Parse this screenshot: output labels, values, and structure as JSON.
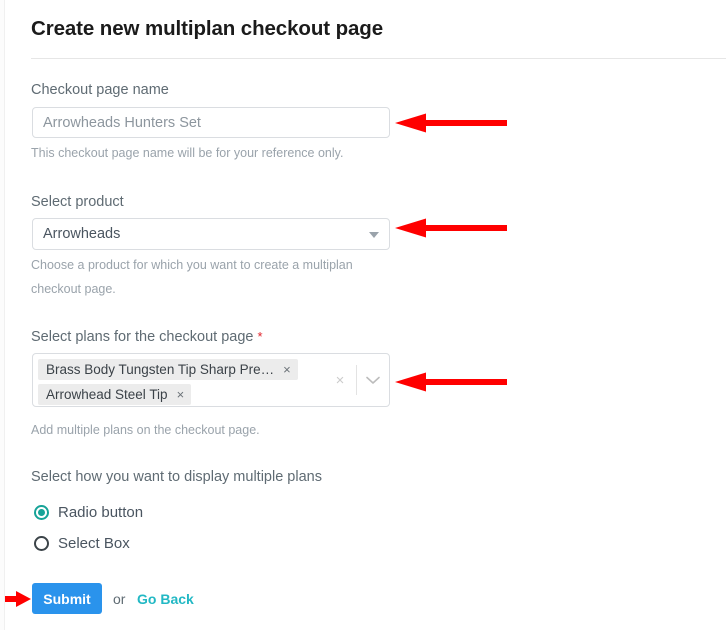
{
  "page": {
    "title": "Create new multiplan checkout page"
  },
  "fields": {
    "checkout_name": {
      "label": "Checkout page name",
      "value": "Arrowheads Hunters Set",
      "placeholder": "Arrowheads Hunters Set",
      "helper": "This checkout page name will be for your reference only."
    },
    "product": {
      "label": "Select product",
      "value": "Arrowheads",
      "helper_line1": "Choose a product for which you want to create a multiplan",
      "helper_line2": "checkout page.",
      "caret_icon": "chevron-down-icon"
    },
    "plans": {
      "label": "Select plans for the checkout page",
      "required_marker": "*",
      "helper": "Add multiple plans on the checkout page.",
      "chips": [
        {
          "label": "Brass Body Tungsten Tip Sharp Pre…",
          "remove_icon": "×"
        },
        {
          "label": "Arrowhead Steel Tip",
          "remove_icon": "×"
        }
      ],
      "clear_icon": "×",
      "dropdown_icon": "chevron-down-icon"
    },
    "display_mode": {
      "label": "Select how you want to display multiple plans",
      "options": [
        {
          "label": "Radio button",
          "selected": true
        },
        {
          "label": "Select Box",
          "selected": false
        }
      ]
    }
  },
  "actions": {
    "submit_label": "Submit",
    "or_label": "or",
    "go_back_label": "Go Back"
  },
  "annotations": {
    "arrow_color": "#FF0000",
    "arrows": [
      {
        "name": "arrow-to-checkout-name-input",
        "direction": "left"
      },
      {
        "name": "arrow-to-product-select",
        "direction": "left"
      },
      {
        "name": "arrow-to-plans-multiselect",
        "direction": "left"
      },
      {
        "name": "arrow-to-submit-button",
        "direction": "right"
      }
    ]
  },
  "colors": {
    "submit_blue": "#2a93ec",
    "link_teal": "#22b8c4",
    "radio_teal": "#17a398",
    "required_red": "#e0242b"
  }
}
